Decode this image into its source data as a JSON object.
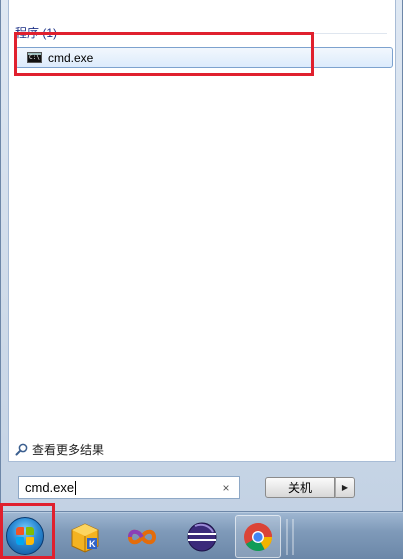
{
  "results": {
    "group_header": "程序 (1)",
    "item_label": "cmd.exe",
    "see_more": "查看更多结果"
  },
  "search": {
    "value": "cmd.exe",
    "clear_glyph": "×"
  },
  "shutdown": {
    "label": "关机",
    "arrow_glyph": "▶"
  },
  "colors": {
    "annotation_red": "#e0202e",
    "group_header_blue": "#1e3287",
    "selection_blue": "#dcebfc"
  },
  "taskbar": {
    "icons": [
      "start-orb",
      "kingsoft-icon",
      "visual-studio-icon",
      "eclipse-icon",
      "chrome-icon"
    ]
  }
}
